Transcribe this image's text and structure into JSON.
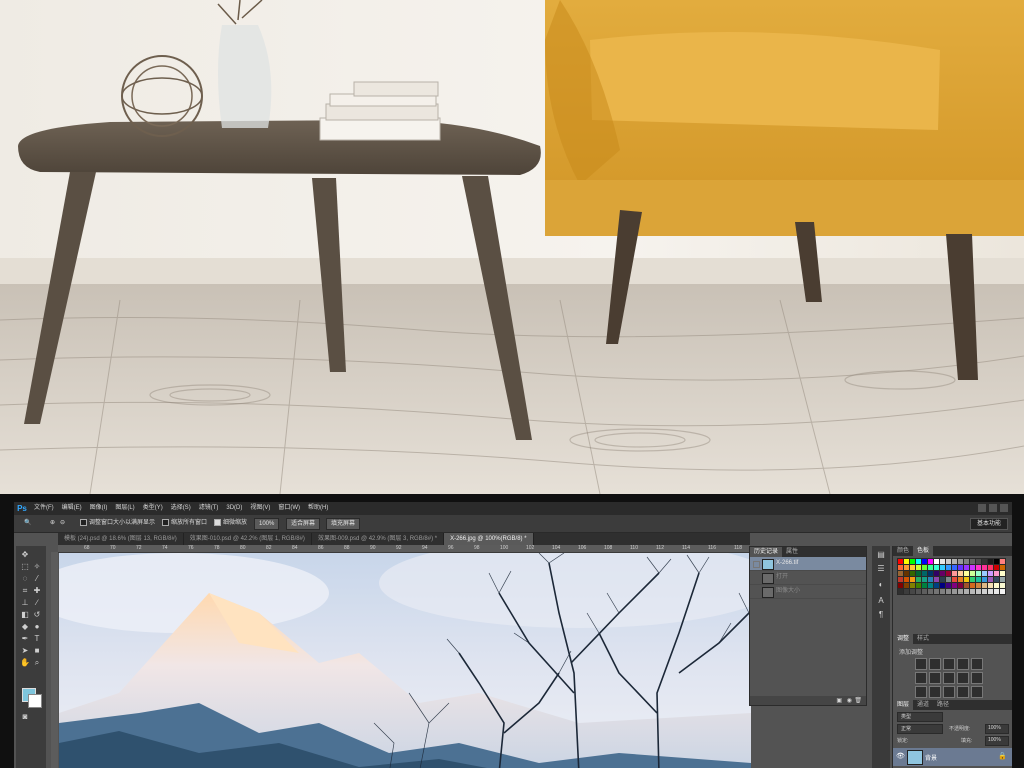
{
  "app": {
    "logo": "Ps",
    "menus": [
      "文件(F)",
      "编辑(E)",
      "图像(I)",
      "图层(L)",
      "类型(Y)",
      "选择(S)",
      "滤镜(T)",
      "3D(D)",
      "视图(V)",
      "窗口(W)",
      "帮助(H)"
    ]
  },
  "options_bar": {
    "resize_windows": "调整窗口大小以满屏显示",
    "zoom_all_windows": "缩放所有窗口",
    "scrubby_zoom": "细微缩放",
    "zoom_value": "100%",
    "fit_screen": "适合屏幕",
    "fill_screen": "填充屏幕",
    "workspace": "基本功能"
  },
  "document_tabs": [
    {
      "label": "模板 (24).psd @ 18.6% (图层 13, RGB/8#)",
      "active": false
    },
    {
      "label": "效果图-010.psd @ 42.2% (图层 1, RGB/8#)",
      "active": false
    },
    {
      "label": "效果图-009.psd @ 42.9% (图层 3, RGB/8#) *",
      "active": false
    },
    {
      "label": "X-266.jpg @ 100%(RGB/8) *",
      "active": true
    }
  ],
  "ruler_marks": [
    "68",
    "70",
    "72",
    "74",
    "76",
    "78",
    "80",
    "82",
    "84",
    "86",
    "88",
    "90",
    "92",
    "94",
    "96",
    "98",
    "100",
    "102",
    "104",
    "106",
    "108",
    "110",
    "112",
    "114",
    "116",
    "118"
  ],
  "history_panel": {
    "tabs": [
      "历史记录",
      "属性"
    ],
    "entries": [
      {
        "label": "X-266.tif",
        "selected": true,
        "dim": false
      },
      {
        "label": "打开",
        "selected": false,
        "dim": true
      },
      {
        "label": "图像大小",
        "selected": false,
        "dim": true
      }
    ]
  },
  "swatches_panel": {
    "tabs": [
      "颜色",
      "色板"
    ]
  },
  "adjustments_panel": {
    "tabs": [
      "调整",
      "样式"
    ],
    "title": "添加调整"
  },
  "layers_panel": {
    "tabs": [
      "图层",
      "通道",
      "路径"
    ],
    "filter_kind": "类型",
    "blend_mode": "正常",
    "opacity_label": "不透明度:",
    "opacity_value": "100%",
    "lock_label": "锁定:",
    "fill_label": "填充:",
    "fill_value": "100%",
    "layer_name": "背景"
  },
  "colors": {
    "foreground": "#7ec5dc",
    "background": "#ffffff",
    "ps_accent": "#31a8ff"
  }
}
